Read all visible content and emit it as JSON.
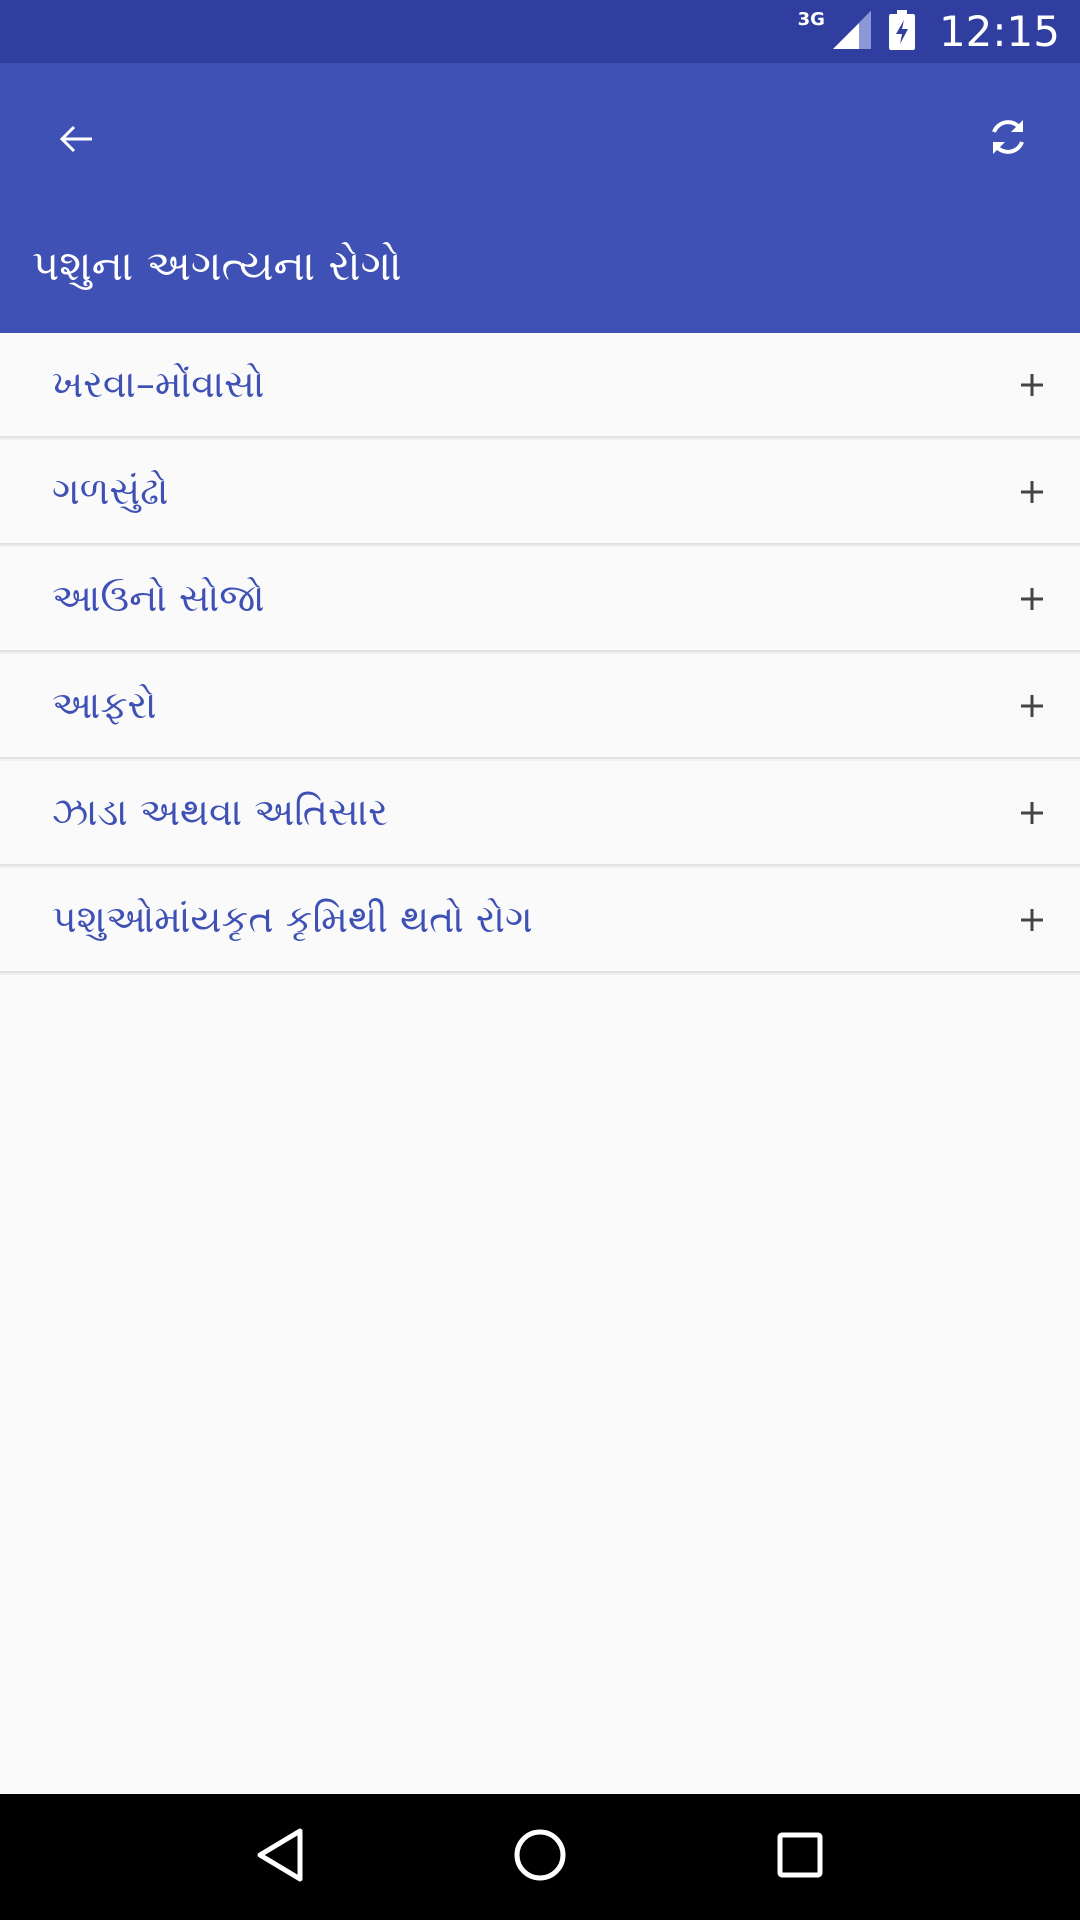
{
  "status_bar": {
    "network": "3G",
    "time": "12:15",
    "icons": [
      "signal-icon",
      "battery-charging-icon"
    ]
  },
  "app_bar": {
    "title": "પશુના અગત્યના રોગો",
    "back_icon": "arrow-back-icon",
    "refresh_icon": "refresh-icon",
    "color": "#3f51b5",
    "status_color": "#303f9f"
  },
  "list": {
    "items": [
      {
        "label": "ખરવા–મોંવાસો",
        "icon": "plus-icon"
      },
      {
        "label": "ગળસુંઢો",
        "icon": "plus-icon"
      },
      {
        "label": "આઉનો સોજો",
        "icon": "plus-icon"
      },
      {
        "label": "આફરો",
        "icon": "plus-icon"
      },
      {
        "label": "ઝાડા અથવા અતિસાર",
        "icon": "plus-icon"
      },
      {
        "label": "પશુઓમાંયકૃત કૃમિથી થતો રોગ",
        "icon": "plus-icon"
      }
    ],
    "label_color": "#3f51b5"
  },
  "nav_bar": {
    "buttons": [
      "back-triangle-icon",
      "home-circle-icon",
      "recents-square-icon"
    ]
  }
}
